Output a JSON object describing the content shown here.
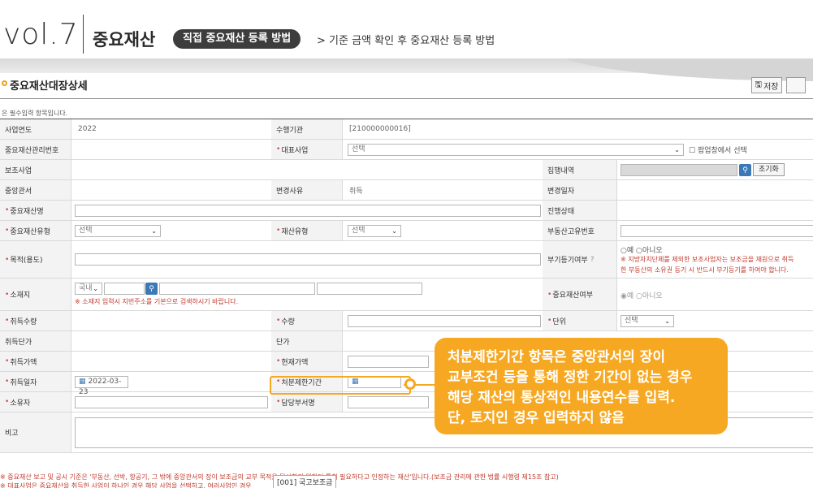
{
  "header": {
    "vol": "vol.7",
    "brand": "중요재산",
    "pill": "직접 중요재산 등록 방법",
    "crumb": "> 기준 금액 확인 후 중요재산 등록 방법"
  },
  "page": {
    "section_title": "중요재산대장상세",
    "save_label": "저장",
    "required_note": "은 필수입력 항목입니다."
  },
  "form": {
    "year_label": "사업연도",
    "year_value": "2022",
    "agency_label": "수행기관",
    "agency_value": "[210000000016]",
    "mgmt_no_label": "중요재산관리번호",
    "main_biz_label": "대표사업",
    "main_biz_value": "선택",
    "popup_select": "팝업창에서 선택",
    "sub_biz_label": "보조사업",
    "exec_label": "집행내역",
    "reset_label": "초기화",
    "ministry_label": "중앙관서",
    "change_reason_label": "변경사유",
    "change_reason_value": "취득",
    "change_date_label": "변경일자",
    "name_label": "중요재산명",
    "status_label": "진행상태",
    "type_label": "중요재산유형",
    "type_value": "선택",
    "asset_type_label": "재산유형",
    "asset_type_value": "선택",
    "realty_no_label": "부동산고유번호",
    "purpose_label": "목적(용도)",
    "reg_label": "부기등기여부",
    "reg_yes": "예",
    "reg_no": "아니오",
    "reg_warn": "※ 지방자치단체를 제외한 보조사업자는 보조금을 재원으로 취득",
    "reg_warn2": "한 부동산의 소유권 등기 시 반드시 부기등기를 하여야 합니다.",
    "location_label": "소재지",
    "location_value": "국내",
    "location_warn": "※ 소재지 입력시 지번주소를 기본으로 검색하시기 바랍니다.",
    "important_label": "중요재산여부",
    "imp_yes": "예",
    "imp_no": "아니오",
    "acq_qty_label": "취득수량",
    "qty_label": "수량",
    "unit_label": "단위",
    "unit_value": "선택",
    "acq_price_label": "취득단가",
    "price_label": "단가",
    "acq_value_label": "취득가액",
    "cur_value_label": "현재가액",
    "acq_date_label": "취득일자",
    "acq_date_value": "2022-03-23",
    "restrict_label": "처분제한기간",
    "owner_label": "소유자",
    "dept_label": "담당부서명",
    "remark_label": "비고"
  },
  "footer": {
    "line1": "※ 중요재산 보고 및 공시 기준은 '부동산, 선박, 항공기, 그 밖에 중앙관서의 장이 보조금의 교부 목적을 달성하기 위하여 특히 필요하다고 인정하는 재산'입니다.(보조금 관리에 관한 법률 시행령 제15조 참고)",
    "line2": "※ 대표사업은 중요재산을 취득한 사업이 하나인 경우 해당 사업을 선택하고, 여러사업인 경우",
    "tooltip": "[001] 국고보조금"
  },
  "callout": {
    "line1": "처분제한기간 항목은 중앙관서의 장이",
    "line2": "교부조건 등을 통해 정한 기간이 없는 경우",
    "line3": "해당 재산의 통상적인 내용연수를 입력.",
    "line4": "단, 토지인 경우 입력하지 않음"
  },
  "colors": {
    "accent": "#f7a822",
    "search_button": "#3c78b6",
    "warning": "#c0392b"
  }
}
